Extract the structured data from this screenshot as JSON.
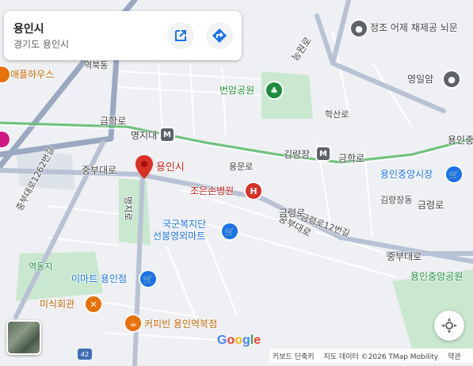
{
  "place_card": {
    "title": "용인시",
    "subtitle": "경기도 용인시",
    "share_icon": "open-in-new-icon",
    "directions_icon": "directions-icon"
  },
  "selected_place": {
    "label": "용인시",
    "pin_color": "#d93025"
  },
  "places": {
    "jeongjo": "정조 어제 채제공 뇌문",
    "beonam_park": "번암공원",
    "yeongil_am": "영일암",
    "apple_house": "애플하우스",
    "cho_eun_son": "조은손병원",
    "gukgun_mart_line1": "국군복지단",
    "gukgun_mart_line2": "선봉영외마트",
    "emart": "이마트 용인점",
    "misik": "미식회관",
    "coffee_bean": "커피빈 용인역북점",
    "yongin_market": "용인중앙시장",
    "yongin_park": "용인중앙공원",
    "yongin_cut": "용인중",
    "yeokdongji": "역동지"
  },
  "stations": {
    "myeongji": "명지대",
    "gimnyangjang": "김량장"
  },
  "roads": {
    "geumhak_1": "금학로",
    "geumhak_2": "금학로",
    "jungbu_1": "중부대로",
    "jungbu_2": "중부대로",
    "jungbu_3": "중부대로",
    "jungbu_1262": "중부대로1262번길",
    "myeongji_ro": "명지로",
    "yongmun_ro": "용문로",
    "geumnyeong_1": "금령로",
    "geumnyeong_2": "금령로",
    "geumnyeong_12": "금령로12번길",
    "haksan_ro": "학산로",
    "neungwon_ro": "능원로",
    "yeokbuk_dong": "역북동",
    "gimnyangjang_dong": "김량장동",
    "route_42": "42"
  },
  "footer": {
    "logo": "Google",
    "shortcuts": "키보드 단축키",
    "data": "지도 데이터 ©2026 TMap Mobility",
    "terms": "약관"
  },
  "colors": {
    "rail_line": "#6dc27a",
    "major_road": "#9aa8c0",
    "park": "#c9e8cf",
    "transit_badge": "#5f6368"
  },
  "icons": {
    "shopping": "shopping-bag-icon",
    "hospital": "hospital-icon",
    "restaurant": "restaurant-icon",
    "cafe": "cafe-icon",
    "park": "tree-icon",
    "temple": "landmark-icon",
    "locate": "my-location-icon",
    "layer": "satellite-layer-icon"
  }
}
